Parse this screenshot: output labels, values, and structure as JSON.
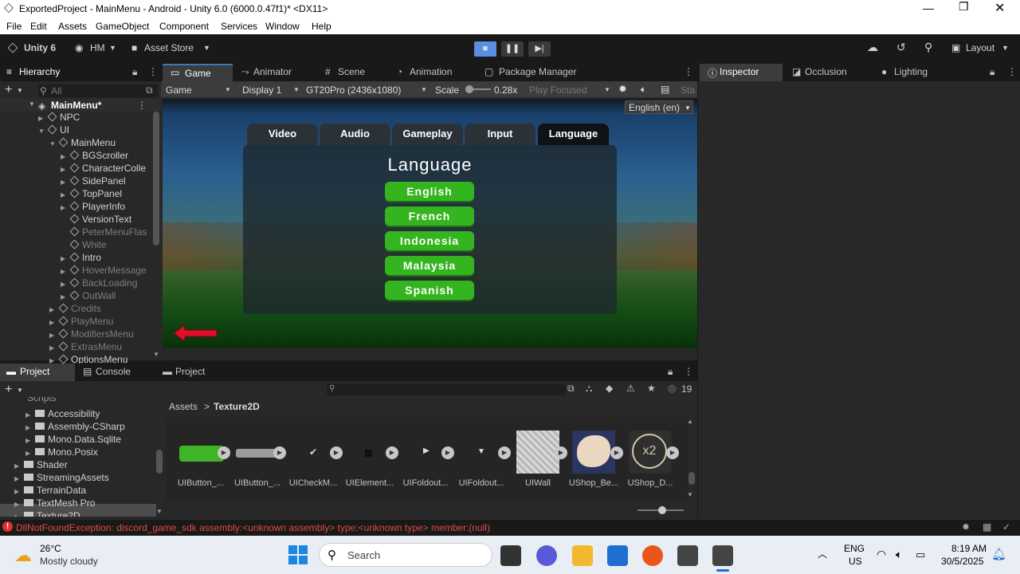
{
  "window": {
    "title": "ExportedProject - MainMenu - Android - Unity 6.0 (6000.0.47f1)* <DX11>"
  },
  "menu": [
    "File",
    "Edit",
    "Assets",
    "GameObject",
    "Component",
    "Services",
    "Window",
    "Help"
  ],
  "toolbar": {
    "unity": "Unity 6",
    "account": "HM",
    "asset_store": "Asset Store",
    "layout": "Layout"
  },
  "hierarchy": {
    "tab": "Hierarchy",
    "search_placeholder": "All",
    "scene": "MainMenu*",
    "rows": [
      {
        "label": "NPC",
        "indent": 1,
        "dim": false,
        "expand": "closed"
      },
      {
        "label": "UI",
        "indent": 1,
        "dim": false,
        "expand": "open"
      },
      {
        "label": "MainMenu",
        "indent": 2,
        "dim": false,
        "expand": "open"
      },
      {
        "label": "BGScroller",
        "indent": 3,
        "dim": false,
        "expand": "closed"
      },
      {
        "label": "CharacterColle",
        "indent": 3,
        "dim": false,
        "expand": "closed"
      },
      {
        "label": "SidePanel",
        "indent": 3,
        "dim": false,
        "expand": "closed"
      },
      {
        "label": "TopPanel",
        "indent": 3,
        "dim": false,
        "expand": "closed"
      },
      {
        "label": "PlayerInfo",
        "indent": 3,
        "dim": false,
        "expand": "closed"
      },
      {
        "label": "VersionText",
        "indent": 3,
        "dim": false,
        "expand": "none"
      },
      {
        "label": "PeterMenuFlas",
        "indent": 3,
        "dim": true,
        "expand": "none"
      },
      {
        "label": "White",
        "indent": 3,
        "dim": true,
        "expand": "none"
      },
      {
        "label": "Intro",
        "indent": 3,
        "dim": false,
        "expand": "closed"
      },
      {
        "label": "HoverMessage",
        "indent": 3,
        "dim": true,
        "expand": "closed"
      },
      {
        "label": "BackLoading",
        "indent": 3,
        "dim": true,
        "expand": "closed"
      },
      {
        "label": "OutWall",
        "indent": 3,
        "dim": true,
        "expand": "closed"
      },
      {
        "label": "Credits",
        "indent": 2,
        "dim": true,
        "expand": "closed"
      },
      {
        "label": "PlayMenu",
        "indent": 2,
        "dim": true,
        "expand": "closed"
      },
      {
        "label": "ModifiersMenu",
        "indent": 2,
        "dim": true,
        "expand": "closed"
      },
      {
        "label": "ExtrasMenu",
        "indent": 2,
        "dim": true,
        "expand": "closed"
      },
      {
        "label": "OptionsMenu",
        "indent": 2,
        "dim": false,
        "expand": "closed"
      }
    ]
  },
  "center_tabs": [
    "Game",
    "Animator",
    "Scene",
    "Animation",
    "Package Manager"
  ],
  "game_toolbar": {
    "view": "Game",
    "display": "Display 1",
    "resolution": "GT20Pro (2436x1080)",
    "scale_label": "Scale",
    "scale_value": "0.28x",
    "play_focused": "Play Focused",
    "stats": "Sta"
  },
  "game": {
    "language_dropdown": "English (en)",
    "tabs": [
      "Video",
      "Audio",
      "Gameplay",
      "Input",
      "Language"
    ],
    "heading": "Language",
    "languages": [
      "English",
      "French",
      "Indonesia",
      "Malaysia",
      "Spanish"
    ]
  },
  "right_tabs": [
    "Inspector",
    "Occlusion",
    "Lighting"
  ],
  "bottom_tabs": [
    "Project",
    "Console",
    "Project"
  ],
  "project": {
    "tree_partial": "Scripts",
    "tree": [
      {
        "label": "Accessibility",
        "indent": 2
      },
      {
        "label": "Assembly-CSharp",
        "indent": 2
      },
      {
        "label": "Mono.Data.Sqlite",
        "indent": 2
      },
      {
        "label": "Mono.Posix",
        "indent": 2
      },
      {
        "label": "Shader",
        "indent": 1
      },
      {
        "label": "StreamingAssets",
        "indent": 1
      },
      {
        "label": "TerrainData",
        "indent": 1
      },
      {
        "label": "TextMesh Pro",
        "indent": 1
      },
      {
        "label": "Texture2D",
        "indent": 1
      }
    ],
    "breadcrumb": [
      "Assets",
      "Texture2D"
    ],
    "count": "19",
    "assets": [
      "UIButton_...",
      "UIButton_...",
      "UICheckM...",
      "UIElement...",
      "UIFoldout...",
      "UIFoldout...",
      "UIWall",
      "UShop_Be...",
      "UShop_D..."
    ]
  },
  "status": {
    "error": "DllNotFoundException: discord_game_sdk assembly:<unknown assembly> type:<unknown type> member:(null)"
  },
  "taskbar": {
    "temp": "26°C",
    "weather": "Mostly cloudy",
    "search": "Search",
    "lang1": "ENG",
    "lang2": "US",
    "time": "8:19 AM",
    "date": "30/5/2025"
  }
}
